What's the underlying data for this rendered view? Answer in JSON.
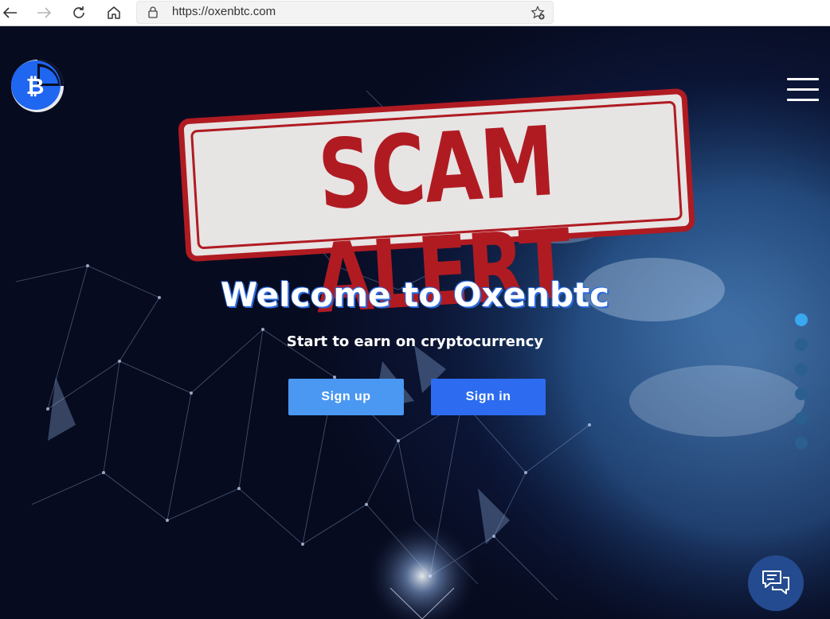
{
  "browser": {
    "url": "https://oxenbtc.com",
    "icons": [
      "back-arrow-icon",
      "forward-arrow-icon",
      "reload-icon",
      "home-icon",
      "lock-icon",
      "favorite-add-icon"
    ]
  },
  "stamp": {
    "text": "SCAM ALERT",
    "color": "#b01b22"
  },
  "hero": {
    "title": "Welcome to Oxenbtc",
    "subtitle": "Start to earn on cryptocurrency",
    "signup_label": "Sign up",
    "signin_label": "Sign in"
  },
  "slider": {
    "count": 6,
    "active_index": 0
  },
  "colors": {
    "accent": "#2d6cf0",
    "accent_light": "#4a98f2",
    "dot_active": "#3aa8f0"
  }
}
